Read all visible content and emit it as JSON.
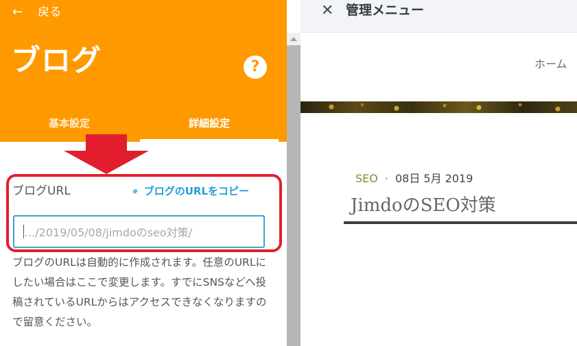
{
  "left_panel": {
    "back_label": "戻る",
    "title": "ブログ",
    "help_icon": "?",
    "tabs": [
      {
        "label": "基本設定",
        "active": false
      },
      {
        "label": "詳細設定",
        "active": true
      }
    ],
    "url_label": "ブログURL",
    "copy_link_label": "ブログのURLをコピー",
    "url_input_value": ".../2019/05/08/jimdoのseo対策/",
    "help_text": "ブログのURLは自動的に作成されます。任意のURLにしたい場合はここで変更します。すでにSNSなどへ投稿されているURLからはアクセスできなくなりますので留意ください。"
  },
  "right_panel": {
    "admin_title": "管理メニュー",
    "nav_home": "ホーム",
    "post": {
      "category": "SEO",
      "separator": "·",
      "date": "08日 5月 2019",
      "title": "JimdoのSEO対策"
    }
  },
  "icons": {
    "back": "arrow-left-icon",
    "link": "link-icon",
    "close": "close-icon",
    "annotation": "arrow-down-icon"
  },
  "colors": {
    "header_orange": "#ff9900",
    "link_blue": "#1ea1d8",
    "input_border": "#3aa4cb",
    "annotation_red": "#e21e2e",
    "category_green": "#7b8e2c"
  }
}
